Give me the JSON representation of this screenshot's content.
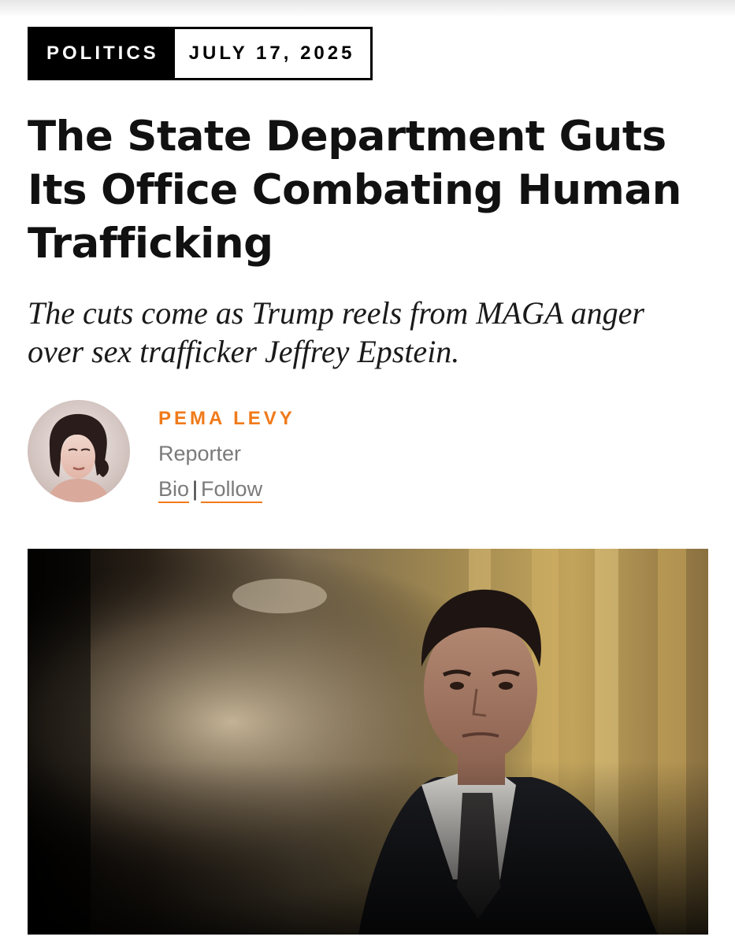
{
  "article": {
    "category": "POLITICS",
    "date": "JULY 17, 2025",
    "headline": "The State Department Guts Its Office Combating Human Trafficking",
    "dek": "The cuts come as Trump reels from MAGA anger over sex trafficker Jeffrey Epstein."
  },
  "author": {
    "name": "PEMA LEVY",
    "role": "Reporter",
    "bio_label": "Bio",
    "separator": "|",
    "follow_label": "Follow"
  },
  "colors": {
    "accent": "#f07a1a",
    "text": "#111111",
    "muted": "#7a7a7a"
  }
}
